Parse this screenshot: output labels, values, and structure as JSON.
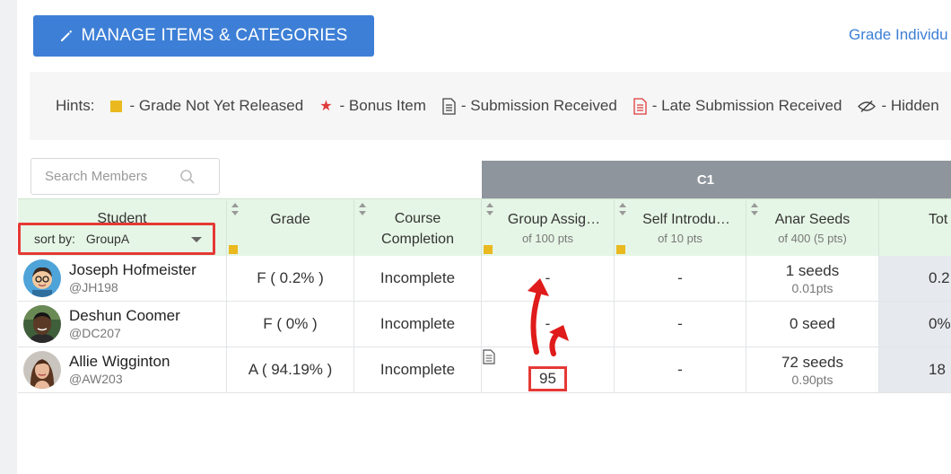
{
  "toolbar": {
    "manage_label": "MANAGE ITEMS & CATEGORIES",
    "grade_link": "Grade Individu"
  },
  "hints": {
    "label": "Hints:",
    "items": [
      {
        "icon": "yellow-square-icon",
        "text": "- Grade Not Yet Released",
        "color": "#e9b91f"
      },
      {
        "icon": "red-star-icon",
        "text": "- Bonus Item",
        "color": "#e03a3a"
      },
      {
        "icon": "document-icon",
        "text": "- Submission Received"
      },
      {
        "icon": "red-document-icon",
        "text": "- Late Submission Received",
        "color": "#e03a3a"
      },
      {
        "icon": "hidden-eye-icon",
        "text": "- Hidden"
      }
    ]
  },
  "search": {
    "placeholder": "Search Members"
  },
  "group_header": "C1",
  "columns": {
    "student": "Student",
    "sort_by_label": "sort by:",
    "sort_by_value": "GroupA",
    "grade": "Grade",
    "course_completion": "Course Completion",
    "group_assignment": {
      "title": "Group Assig…",
      "sub": "of 100 pts"
    },
    "self_intro": {
      "title": "Self Introdu…",
      "sub": "of 10 pts"
    },
    "anar_seeds": {
      "title": "Anar Seeds",
      "sub": "of 400 (5 pts)"
    },
    "total": "Tot"
  },
  "rows": [
    {
      "name": "Joseph Hofmeister",
      "handle": "@JH198",
      "grade": "F ( 0.2% )",
      "completion": "Incomplete",
      "group": "-",
      "self": "-",
      "seeds": "1 seeds",
      "seeds_pts": "0.01pts",
      "total": "0.2"
    },
    {
      "name": "Deshun Coomer",
      "handle": "@DC207",
      "grade": "F ( 0% )",
      "completion": "Incomplete",
      "group": "-",
      "self": "-",
      "seeds": "0 seed",
      "seeds_pts": "",
      "total": "0%"
    },
    {
      "name": "Allie Wigginton",
      "handle": "@AW203",
      "grade": "A ( 94.19% )",
      "completion": "Incomplete",
      "group": "95",
      "self": "-",
      "seeds": "72 seeds",
      "seeds_pts": "0.90pts",
      "total": "18"
    }
  ],
  "colors": {
    "accent": "#3d7fd6",
    "highlight": "#e53935",
    "header_green": "#e6f6e6",
    "group_gray": "#8f959c"
  }
}
